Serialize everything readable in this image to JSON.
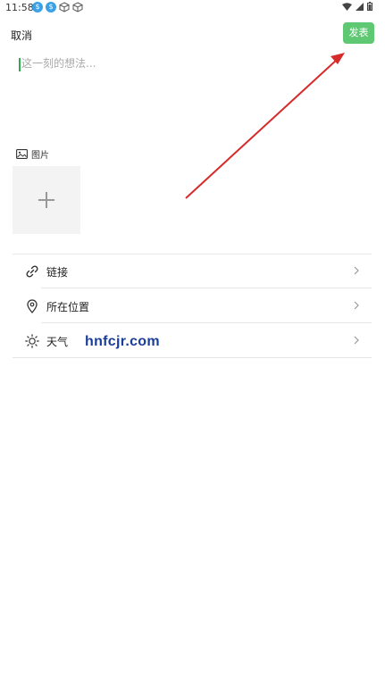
{
  "status_bar": {
    "time": "11:58",
    "left_icons": [
      "notification-badge-icon",
      "notification-badge-icon",
      "box-icon",
      "box-icon"
    ],
    "right_icons": [
      "wifi-icon",
      "signal-icon",
      "battery-icon"
    ]
  },
  "header": {
    "cancel_label": "取消",
    "publish_label": "发表",
    "publish_color": "#5ec873"
  },
  "composer": {
    "placeholder": "这一刻的想法...",
    "value": ""
  },
  "images": {
    "label": "图片",
    "add_icon": "plus-icon"
  },
  "options": [
    {
      "label": "链接",
      "icon": "link-icon"
    },
    {
      "label": "所在位置",
      "icon": "location-pin-icon"
    },
    {
      "label": "天气",
      "icon": "sun-icon"
    }
  ],
  "watermark": "hnfcjr.com",
  "annotation": {
    "arrow_color": "#d62b2b"
  }
}
